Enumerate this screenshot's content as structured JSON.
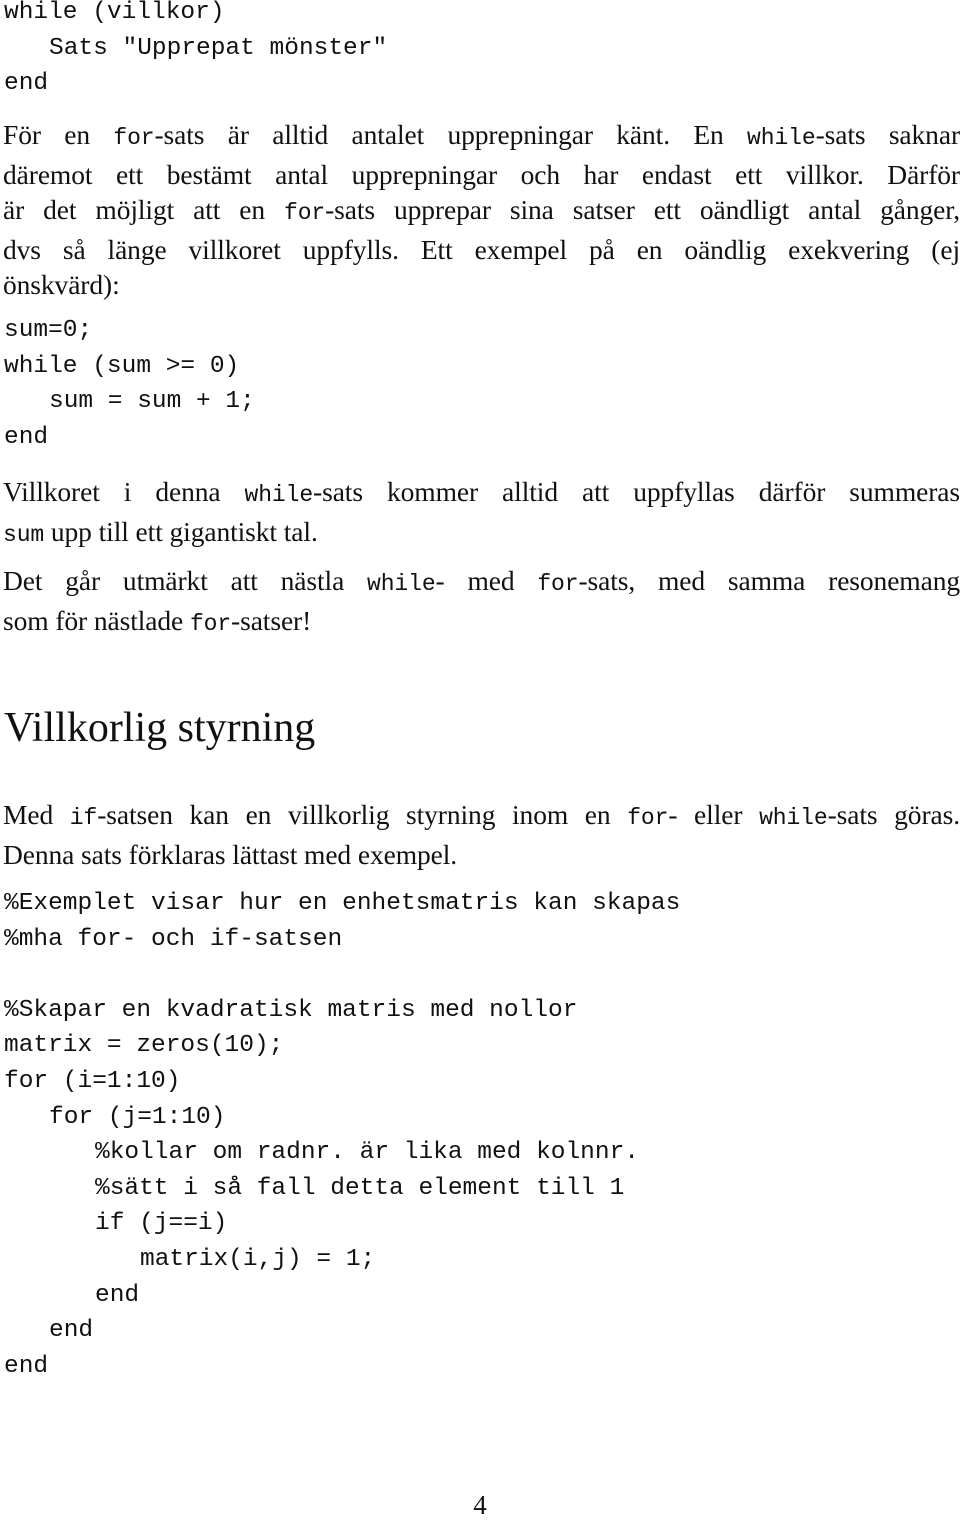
{
  "code_block_1": {
    "lines": [
      "while (villkor)",
      "Sats \"Upprepat mönster\"",
      "end"
    ]
  },
  "paragraph_1": {
    "lines": [
      [
        "För en ",
        {
          "code": "for"
        },
        "-sats är alltid antalet upprepningar känt. En ",
        {
          "code": "while"
        },
        "-sats saknar"
      ],
      [
        "däremot ett bestämt antal upprepningar och har endast ett villkor. Därför"
      ],
      [
        "är det möjligt att en ",
        {
          "code": "for"
        },
        "-sats upprepar sina satser ett oändligt antal gånger,"
      ],
      [
        "dvs så länge villkoret uppfylls. Ett exempel på en oändlig exekvering (ej"
      ],
      [
        "önskvärd):"
      ]
    ]
  },
  "code_block_2": {
    "lines": [
      "sum=0;",
      "while (sum >= 0)",
      "sum = sum + 1;",
      "end"
    ]
  },
  "paragraph_2": {
    "lines": [
      [
        "Villkoret i denna ",
        {
          "code": "while"
        },
        "-sats kommer alltid att uppfyllas därför summeras"
      ],
      [
        {
          "code": "sum"
        },
        " upp till ett gigantiskt tal."
      ]
    ]
  },
  "paragraph_3": {
    "lines": [
      [
        "Det går utmärkt att nästla ",
        {
          "code": "while"
        },
        "- med ",
        {
          "code": "for"
        },
        "-sats, med samma resonemang"
      ],
      [
        "som för nästlade ",
        {
          "code": "for"
        },
        "-satser!"
      ]
    ]
  },
  "section_heading": "Villkorlig styrning",
  "paragraph_4": {
    "lines": [
      [
        "Med ",
        {
          "code": "if"
        },
        "-satsen kan en villkorlig styrning inom en ",
        {
          "code": "for"
        },
        "- eller ",
        {
          "code": "while"
        },
        "-sats göras."
      ],
      [
        "Denna sats förklaras lättast med exempel."
      ]
    ]
  },
  "code_block_3": {
    "lines": [
      "%Exemplet visar hur en enhetsmatris kan skapas",
      "%mha for- och if-satsen",
      "",
      "%Skapar en kvadratisk matris med nollor",
      "matrix = zeros(10);",
      "for (i=1:10)",
      "for (j=1:10)",
      "%kollar om radnr. är lika med kolnnr.",
      "%sätt i så fall detta element till 1",
      "if (j==i)",
      "matrix(i,j) = 1;",
      "end",
      "end",
      "end"
    ]
  },
  "page_number": "4"
}
